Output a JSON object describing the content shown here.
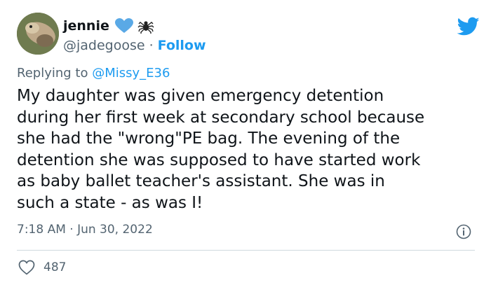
{
  "user": {
    "name": "jennie",
    "handle": "@jadegoose",
    "separator": "·",
    "follow_label": "Follow",
    "emoji": [
      "blue-heart-icon",
      "spider-icon"
    ]
  },
  "reply": {
    "prefix": "Replying to ",
    "mention": "@Missy_E36"
  },
  "tweet": {
    "text": "My daughter was given emergency detention\nduring her first week at secondary school because\nshe had the \"wrong\"PE bag.  The evening of the\ndetention she was supposed to have started work\nas baby ballet teacher's assistant.  She was in\nsuch a state - as was I!"
  },
  "meta": {
    "timestamp": "7:18 AM · Jun 30, 2022"
  },
  "actions": {
    "likes": "487"
  },
  "colors": {
    "accent": "#1d9bf0",
    "secondary_text": "#536471",
    "divider": "#cfd9de"
  }
}
